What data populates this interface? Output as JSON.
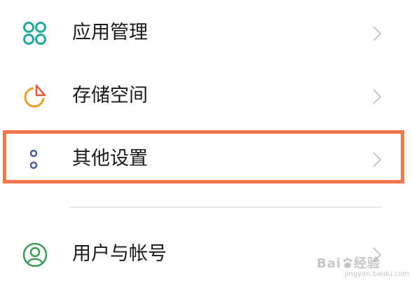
{
  "settings_list": {
    "items": [
      {
        "label": "应用管理",
        "icon": "apps-grid-icon",
        "icon_color": "#22a89a"
      },
      {
        "label": "存储空间",
        "icon": "storage-pie-icon",
        "icon_color": "#e6a11f",
        "icon_accent": "#e25b45"
      },
      {
        "label": "其他设置",
        "icon": "more-dots-icon",
        "icon_color": "#4a5f97"
      },
      {
        "label": "用户与帐号",
        "icon": "user-account-icon",
        "icon_color": "#3f9a5a"
      }
    ],
    "highlight_color": "#f2764a"
  },
  "watermark": {
    "brand_prefix": "Bai",
    "brand_suffix": "经验",
    "sub_text": "jingyan.baidu.com"
  }
}
